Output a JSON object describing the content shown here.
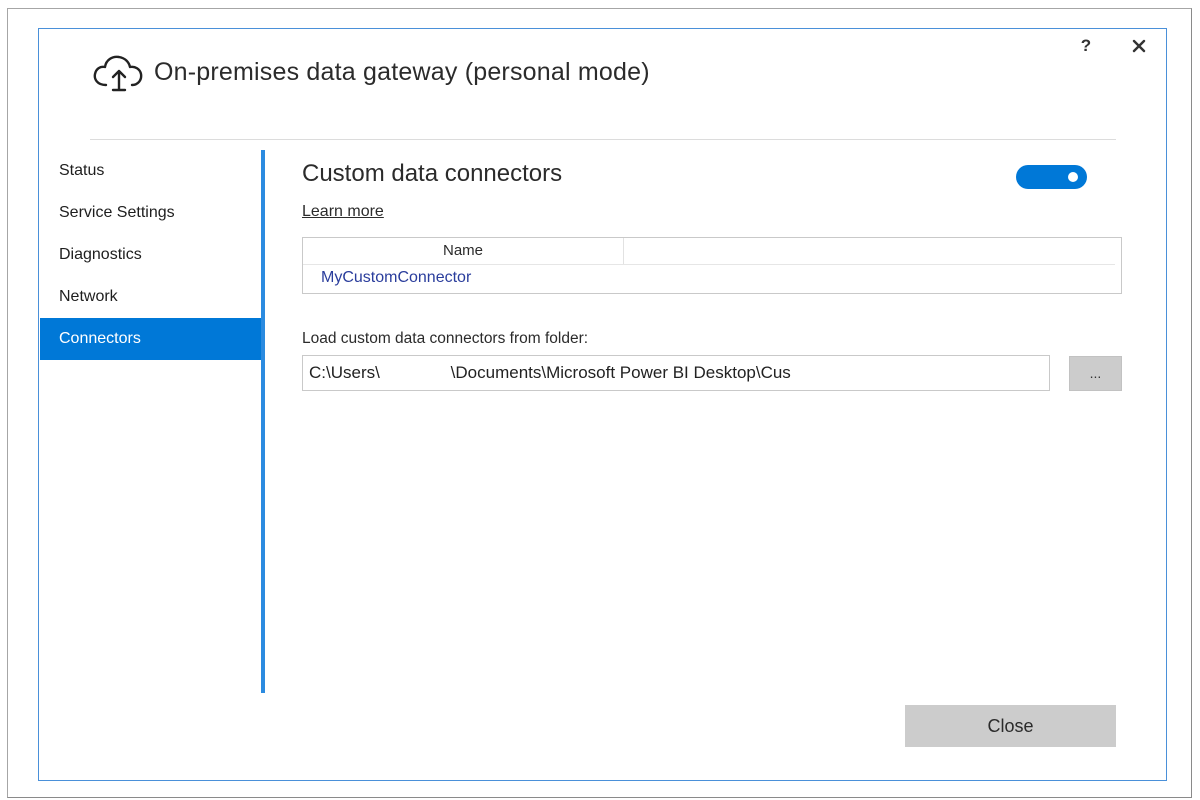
{
  "window": {
    "title": "On-premises data gateway (personal mode)",
    "help_label": "?",
    "app_icon": "cloud-upload-icon",
    "close_icon": "close-icon"
  },
  "sidebar": {
    "items": [
      {
        "label": "Status",
        "active": false
      },
      {
        "label": "Service Settings",
        "active": false
      },
      {
        "label": "Diagnostics",
        "active": false
      },
      {
        "label": "Network",
        "active": false
      },
      {
        "label": "Connectors",
        "active": true
      }
    ]
  },
  "main": {
    "section_title": "Custom data connectors",
    "toggle": {
      "state": "on"
    },
    "learn_more": "Learn more",
    "table": {
      "columns": [
        "Name"
      ],
      "rows": [
        {
          "name": "MyCustomConnector"
        }
      ]
    },
    "folder_label": "Load custom data connectors from folder:",
    "folder_value": "C:\\Users\\               \\Documents\\Microsoft Power BI Desktop\\Cus",
    "browse_label": "..."
  },
  "footer": {
    "close_label": "Close"
  },
  "colors": {
    "accent": "#0078d7",
    "dialog_border": "#4a90d9",
    "connector_text": "#2a3d9c",
    "button_gray": "#cccccc"
  }
}
